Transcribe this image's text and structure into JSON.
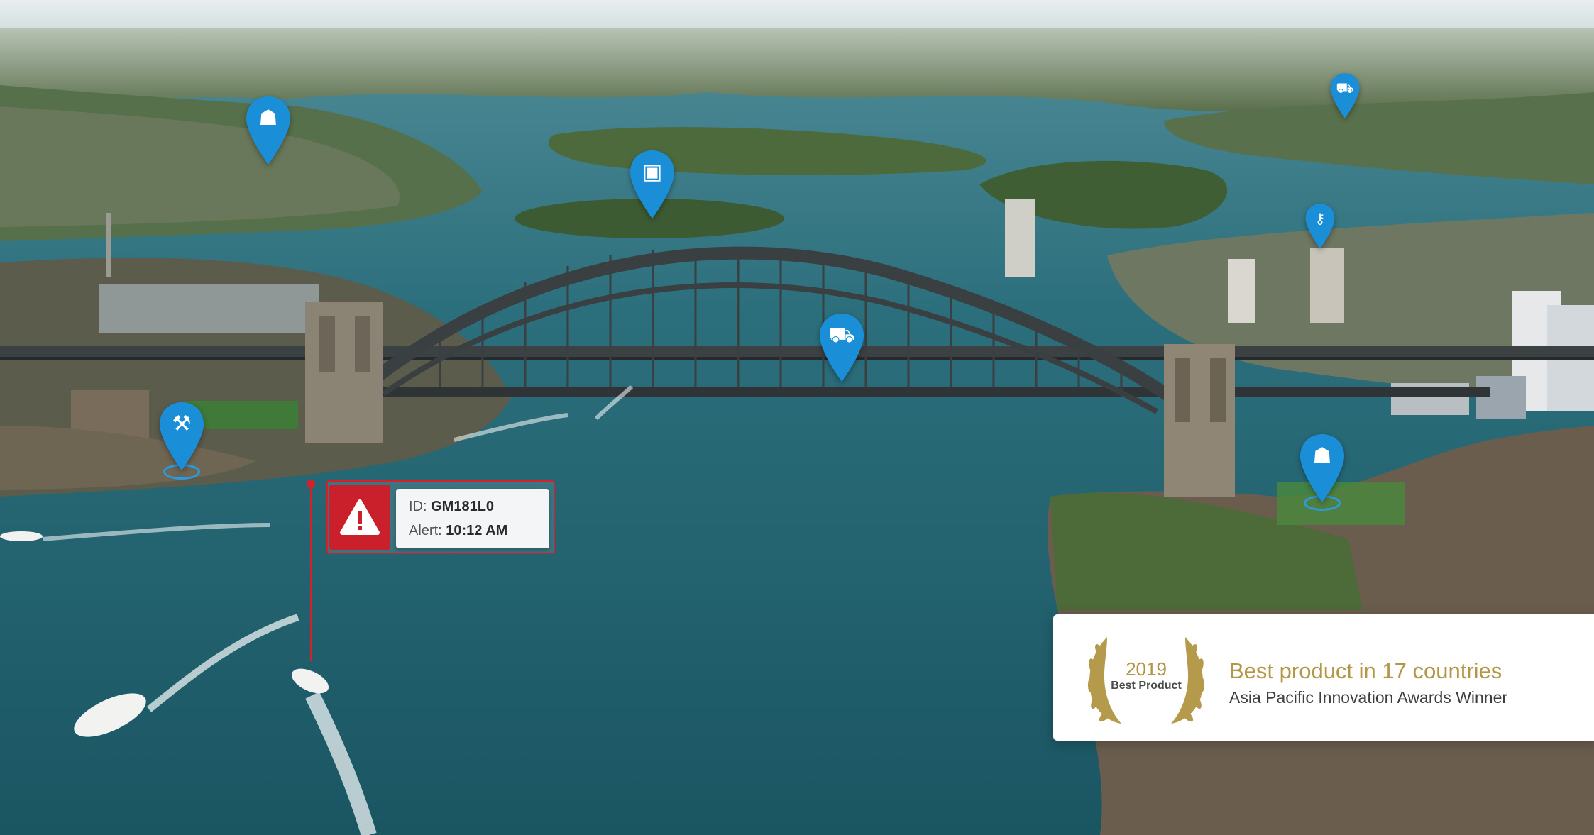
{
  "alert": {
    "id_label": "ID:",
    "id_value": "GM181L0",
    "time_label": "Alert:",
    "time_value": "10:12 AM",
    "icon": "warning-triangle-icon",
    "color": "#d3212c"
  },
  "award": {
    "year": "2019",
    "badge": "Best Product",
    "headline": "Best product in 17 countries",
    "subline": "Asia Pacific Innovation Awards Winner",
    "gold": "#b39648"
  },
  "pins": [
    {
      "name": "worker-pin",
      "icon": "worker-icon",
      "glyph": "☗"
    },
    {
      "name": "briefcase-pin",
      "icon": "briefcase-icon",
      "glyph": "▣"
    },
    {
      "name": "car-pin",
      "icon": "car-icon",
      "glyph": "⛟"
    },
    {
      "name": "key-pin",
      "icon": "key-icon",
      "glyph": "⚷"
    },
    {
      "name": "truck-pin",
      "icon": "truck-icon",
      "glyph": "⛟"
    },
    {
      "name": "tools-pin",
      "icon": "tools-icon",
      "glyph": "⚒"
    },
    {
      "name": "worker-pin-2",
      "icon": "worker-icon",
      "glyph": "☗"
    }
  ],
  "colors": {
    "pin": "#1a8fd8",
    "water": "#1f6272"
  }
}
